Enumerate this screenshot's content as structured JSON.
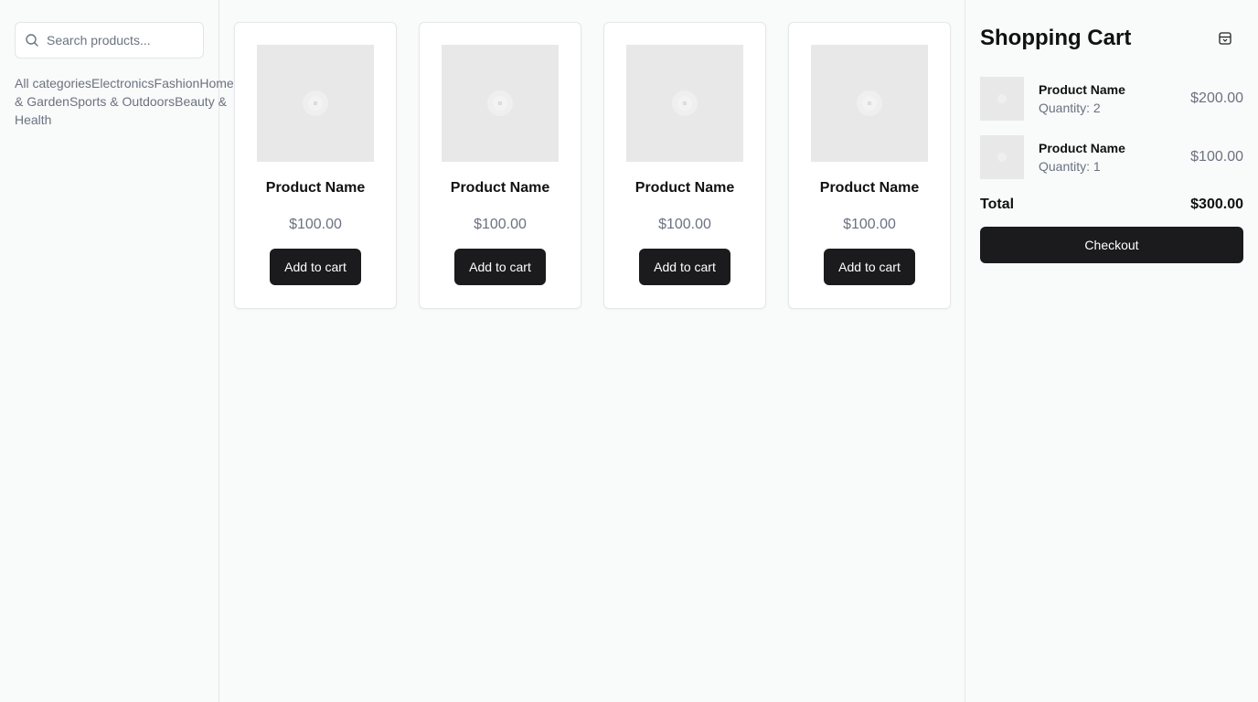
{
  "search": {
    "placeholder": "Search products...",
    "value": ""
  },
  "categories": [
    "All categories",
    "Electronics",
    "Fashion",
    "Home & Garden",
    "Sports & Outdoors",
    "Beauty & Health"
  ],
  "products": [
    {
      "name": "Product Name",
      "price": "$100.00",
      "button": "Add to cart"
    },
    {
      "name": "Product Name",
      "price": "$100.00",
      "button": "Add to cart"
    },
    {
      "name": "Product Name",
      "price": "$100.00",
      "button": "Add to cart"
    },
    {
      "name": "Product Name",
      "price": "$100.00",
      "button": "Add to cart"
    }
  ],
  "cart": {
    "title": "Shopping Cart",
    "items": [
      {
        "name": "Product Name",
        "quantity": "Quantity: 2",
        "price": "$200.00"
      },
      {
        "name": "Product Name",
        "quantity": "Quantity: 1",
        "price": "$100.00"
      }
    ],
    "total_label": "Total",
    "total_value": "$300.00",
    "checkout_label": "Checkout"
  },
  "icons": {
    "search": "search-icon",
    "placeholder_image": "image-placeholder-icon",
    "cart_panel": "archive-icon"
  },
  "colors": {
    "primary_button": "#1b1b1d",
    "muted_text": "#6b7280",
    "placeholder_bg": "#e8e8e8",
    "page_bg": "#f9fafa"
  }
}
